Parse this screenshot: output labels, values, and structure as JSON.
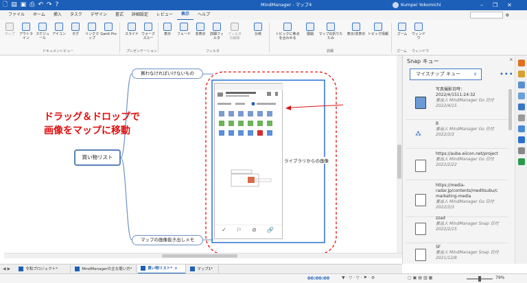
{
  "window": {
    "title": "MindManager - マップ4",
    "user": "Kumpei Yokomichi"
  },
  "menubar": {
    "tabs": [
      "ファイル",
      "ホーム",
      "挿入",
      "タスク",
      "デザイン",
      "書式",
      "詳細設定",
      "レビュー",
      "表示",
      "ヘルプ"
    ],
    "active": "表示"
  },
  "ribbon": {
    "buttons": [
      {
        "label": "マップ",
        "gray": true
      },
      {
        "label": "アウトライン",
        "gray": false
      },
      {
        "label": "スケジュール",
        "gray": false
      },
      {
        "label": "アイコン",
        "gray": false
      },
      {
        "label": "タグ",
        "gray": false
      },
      {
        "label": "リンクマップ",
        "gray": false
      },
      {
        "label": "Gantt Pro",
        "gray": false
      },
      {
        "label": "スライド",
        "gray": false
      },
      {
        "label": "ウォークスルー",
        "gray": false
      },
      {
        "label": "表示",
        "gray": false
      },
      {
        "label": "フェード",
        "gray": false
      },
      {
        "label": "非表示",
        "gray": false
      },
      {
        "label": "詳細フィルタ",
        "gray": false
      },
      {
        "label": "フィルタの解除",
        "gray": true
      },
      {
        "label": "分岐",
        "gray": false
      },
      {
        "label": "トピックに焦点を合わせる",
        "gray": false
      },
      {
        "label": "展開",
        "gray": false
      },
      {
        "label": "マップの折りたたみ",
        "gray": false
      },
      {
        "label": "表示/非表示",
        "gray": false
      },
      {
        "label": "トピック情報",
        "gray": false
      },
      {
        "label": "ズーム",
        "gray": false
      },
      {
        "label": "ウィンドウ",
        "gray": false
      }
    ],
    "groups": [
      "ドキュメントビュー",
      "プレゼンテーション",
      "フィルタ",
      "詳細",
      "ズーム",
      "ウィンドウ"
    ]
  },
  "map": {
    "central": "買い物リスト",
    "topics": [
      "買わなければいけないもの",
      "ライブラリからの画像",
      "マップの画像抜き出しメモ"
    ],
    "annotation_line1": "ドラッグ＆ドロップで",
    "annotation_line2": "画像をマップに移動"
  },
  "snap": {
    "header": "Snap キュー",
    "dropdown": "マイスナップ キュー",
    "items": [
      {
        "line1": "写真撮影日時：",
        "line2": "2022/4/1511:24:32",
        "meta": "差出人 MindManager Go 日付 2022/4/15"
      },
      {
        "line1": "B",
        "line2": "",
        "meta": "差出人 MindManager Go 日付 2022/3/3"
      },
      {
        "line1": "https://auba.eiicon.net/project",
        "line2": "",
        "meta": "差出人 MindManager Go 日付 2022/2/22"
      },
      {
        "line1": "https://media-",
        "line2": "radar.jp/contents/meditsubu/c marketing-media",
        "meta": "差出人 MindManager Go 日付 2022/3/3"
      },
      {
        "line1": "zzad",
        "line2": "",
        "meta": "差出人 MindManager Snap 日付 2022/2/15"
      },
      {
        "line1": "SF",
        "line2": "",
        "meta": "差出人 MindManager Snap 日付 2021/12/8"
      }
    ]
  },
  "doctabs": [
    "令和プロジェクト*",
    "MindManagerの主な使い方*",
    "買い物リスト*",
    "マップ1*"
  ],
  "doctabs_active": 2,
  "status": {
    "timer": "00:00:00",
    "zoom": "79%"
  },
  "colors": {
    "accent": "#1c5fb8",
    "annotation": "#e01010"
  }
}
